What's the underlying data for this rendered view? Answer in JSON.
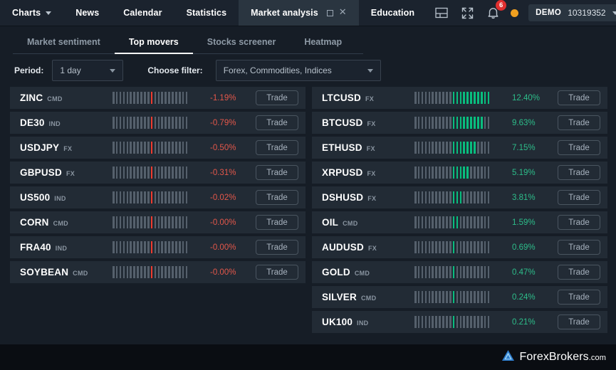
{
  "topbar": {
    "nav_items": [
      {
        "label": "Charts",
        "icon": "chevron-down-icon",
        "has_caret": true,
        "active": false
      },
      {
        "label": "News",
        "has_caret": false,
        "active": false
      },
      {
        "label": "Calendar",
        "has_caret": false,
        "active": false
      },
      {
        "label": "Statistics",
        "has_caret": false,
        "active": false
      },
      {
        "label": "Market analysis",
        "has_caret": false,
        "active": true
      },
      {
        "label": "Education",
        "has_caret": false,
        "active": false
      }
    ],
    "tab_controls": {
      "maximize": "maximize-icon",
      "close": "close-icon"
    },
    "icons": {
      "layout": "layout-panel-icon",
      "fullscreen": "fullscreen-icon",
      "notifications": "bell-icon",
      "status": "status-dot-icon",
      "power": "power-icon"
    },
    "notification_count": "6",
    "account": {
      "type": "DEMO",
      "number": "10319352",
      "caret": "chevron-down-icon"
    }
  },
  "subtabs": [
    {
      "label": "Market sentiment",
      "active": false
    },
    {
      "label": "Top movers",
      "active": true
    },
    {
      "label": "Stocks screener",
      "active": false
    },
    {
      "label": "Heatmap",
      "active": false
    }
  ],
  "filters": {
    "period_label": "Period:",
    "period_value": "1 day",
    "choose_label": "Choose filter:",
    "choose_value": "Forex, Commodities, Indices"
  },
  "colors": {
    "up": "#09bd7e",
    "down": "#f03b2e",
    "bar_neutral": "#55606c",
    "row_bg": "#222b35",
    "page_bg": "#161d26",
    "accent_badge": "#e02f2f",
    "status": "#f0a020"
  },
  "trade_label": "Trade",
  "losers": [
    {
      "symbol": "ZINC",
      "class": "CMD",
      "pct": "-1.19%",
      "direction": "down",
      "marked": 1
    },
    {
      "symbol": "DE30",
      "class": "IND",
      "pct": "-0.79%",
      "direction": "down",
      "marked": 1
    },
    {
      "symbol": "USDJPY",
      "class": "FX",
      "pct": "-0.50%",
      "direction": "down",
      "marked": 1
    },
    {
      "symbol": "GBPUSD",
      "class": "FX",
      "pct": "-0.31%",
      "direction": "down",
      "marked": 1
    },
    {
      "symbol": "US500",
      "class": "IND",
      "pct": "-0.02%",
      "direction": "down",
      "marked": 1
    },
    {
      "symbol": "CORN",
      "class": "CMD",
      "pct": "-0.00%",
      "direction": "down",
      "marked": 1
    },
    {
      "symbol": "FRA40",
      "class": "IND",
      "pct": "-0.00%",
      "direction": "down",
      "marked": 1
    },
    {
      "symbol": "SOYBEAN",
      "class": "CMD",
      "pct": "-0.00%",
      "direction": "down",
      "marked": 1
    }
  ],
  "gainers": [
    {
      "symbol": "LTCUSD",
      "class": "FX",
      "pct": "12.40%",
      "direction": "up",
      "marked": 11
    },
    {
      "symbol": "BTCUSD",
      "class": "FX",
      "pct": "9.63%",
      "direction": "up",
      "marked": 9
    },
    {
      "symbol": "ETHUSD",
      "class": "FX",
      "pct": "7.15%",
      "direction": "up",
      "marked": 7
    },
    {
      "symbol": "XRPUSD",
      "class": "FX",
      "pct": "5.19%",
      "direction": "up",
      "marked": 5
    },
    {
      "symbol": "DSHUSD",
      "class": "FX",
      "pct": "3.81%",
      "direction": "up",
      "marked": 3
    },
    {
      "symbol": "OIL",
      "class": "CMD",
      "pct": "1.59%",
      "direction": "up",
      "marked": 2
    },
    {
      "symbol": "AUDUSD",
      "class": "FX",
      "pct": "0.69%",
      "direction": "up",
      "marked": 1
    },
    {
      "symbol": "GOLD",
      "class": "CMD",
      "pct": "0.47%",
      "direction": "up",
      "marked": 1
    },
    {
      "symbol": "SILVER",
      "class": "CMD",
      "pct": "0.24%",
      "direction": "up",
      "marked": 1
    },
    {
      "symbol": "UK100",
      "class": "IND",
      "pct": "0.21%",
      "direction": "up",
      "marked": 1
    }
  ],
  "bar_meter": {
    "total": 22,
    "center_index": 11
  },
  "footer": {
    "logo_name": "ForexBrokers",
    "logo_suffix": ".com",
    "logo_icon": "forexbrokers-pyramid-icon"
  }
}
